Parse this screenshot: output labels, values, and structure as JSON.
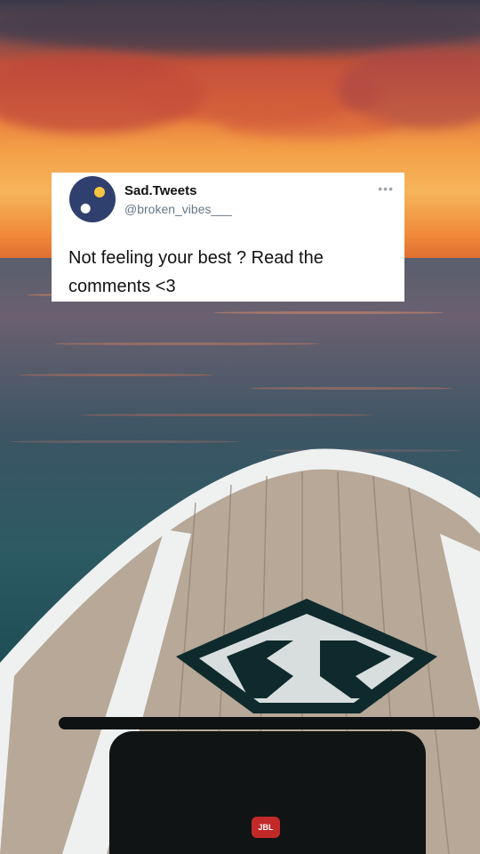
{
  "tweet": {
    "display_name": "Sad.Tweets",
    "handle": "@broken_vibes___",
    "text": "Not feeling your best ? Read the comments <3",
    "more_icon": "more-dots-icon"
  },
  "speaker": {
    "logo_text": "JBL"
  }
}
